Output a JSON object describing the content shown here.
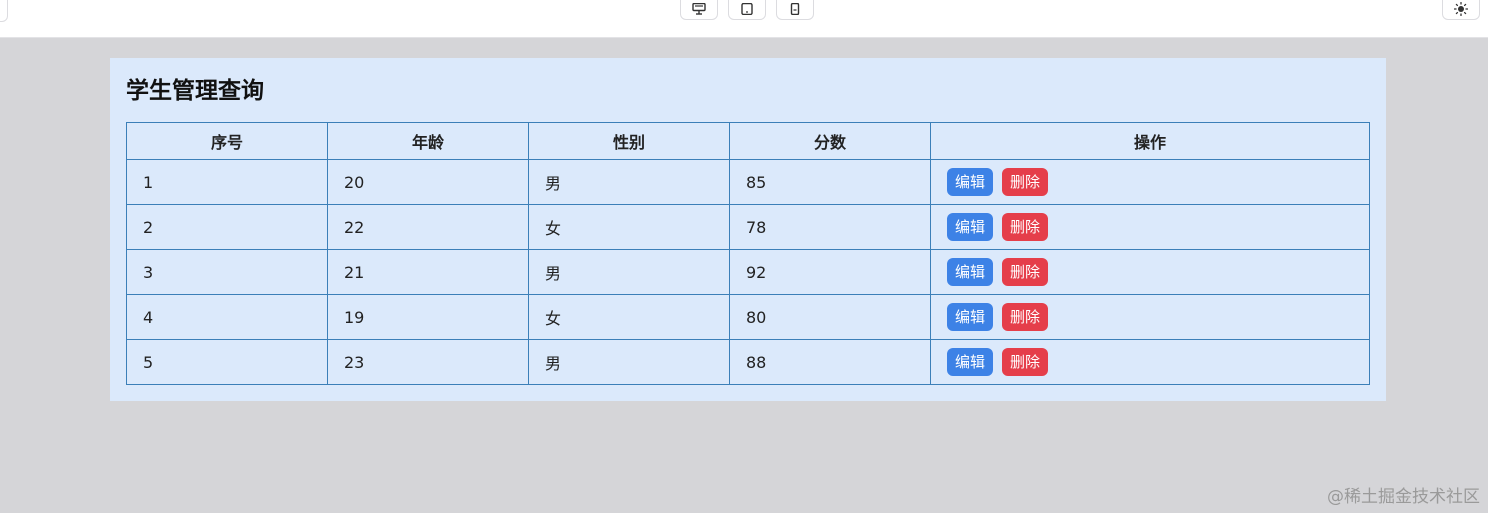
{
  "icons": {
    "desktop": "desktop-icon",
    "tablet": "tablet-icon",
    "mobile": "mobile-icon",
    "theme": "sun-icon"
  },
  "page": {
    "title": "学生管理查询"
  },
  "table": {
    "headers": [
      "序号",
      "年龄",
      "性别",
      "分数",
      "操作"
    ],
    "rows": [
      {
        "index": "1",
        "age": "20",
        "gender": "男",
        "score": "85"
      },
      {
        "index": "2",
        "age": "22",
        "gender": "女",
        "score": "78"
      },
      {
        "index": "3",
        "age": "21",
        "gender": "男",
        "score": "92"
      },
      {
        "index": "4",
        "age": "19",
        "gender": "女",
        "score": "80"
      },
      {
        "index": "5",
        "age": "23",
        "gender": "男",
        "score": "88"
      }
    ],
    "edit_label": "编辑",
    "delete_label": "删除"
  },
  "colors": {
    "panel_bg": "#dbe9fb",
    "border": "#3b7fb8",
    "edit_button": "#3d82e6",
    "delete_button": "#e53e4a"
  },
  "watermark": "@稀土掘金技术社区"
}
